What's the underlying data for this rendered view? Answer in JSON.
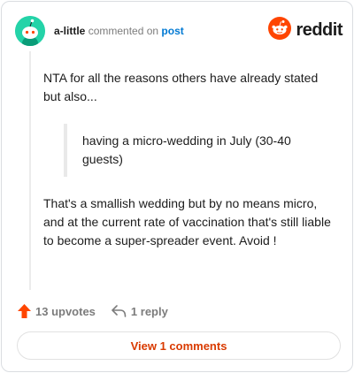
{
  "header": {
    "username": "a-little",
    "action": "commented on",
    "target": "post",
    "brand": "reddit"
  },
  "comment": {
    "paragraph1": "NTA for all the reasons others have already stated but also...",
    "quote": "having a micro-wedding in July (30-40 guests)",
    "paragraph2": "That's a smallish wedding but by no means micro, and at the current rate of vaccination that's still liable to become a super-spreader event. Avoid !"
  },
  "actions": {
    "upvotes": "13 upvotes",
    "replies": "1 reply"
  },
  "footer": {
    "view_comments": "View 1 comments"
  },
  "colors": {
    "avatar": "#24d3a8",
    "upvote": "#ff4500",
    "link": "#0079d3",
    "view_button_text": "#d93a00"
  },
  "icons": {
    "avatar": "snoo-avatar-icon",
    "brand": "reddit-logo-icon",
    "upvote": "upvote-arrow-icon",
    "reply": "reply-arrow-icon"
  }
}
